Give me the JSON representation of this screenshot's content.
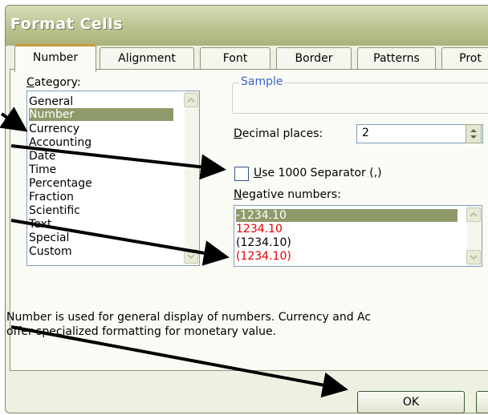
{
  "dialog": {
    "title": "Format Cells"
  },
  "tabs": [
    {
      "label": "Number"
    },
    {
      "label": "Alignment"
    },
    {
      "label": "Font"
    },
    {
      "label": "Border"
    },
    {
      "label": "Patterns"
    },
    {
      "label": "Prot"
    }
  ],
  "category": {
    "label_accel": "C",
    "label_rest": "ategory:",
    "items": [
      "General",
      "Number",
      "Currency",
      "Accounting",
      "Date",
      "Time",
      "Percentage",
      "Fraction",
      "Scientific",
      "Text",
      "Special",
      "Custom"
    ],
    "selected": "Number"
  },
  "sample": {
    "legend": "Sample",
    "value": ""
  },
  "decimal_places": {
    "label_accel": "D",
    "label_rest": "ecimal places:",
    "value": "2"
  },
  "separator": {
    "label_accel": "U",
    "label_rest": "se 1000 Separator (,)",
    "checked": false
  },
  "negative_numbers": {
    "label_accel": "N",
    "label_rest": "egative numbers:",
    "items": [
      {
        "text": "-1234.10",
        "color": "#000000",
        "selected": true
      },
      {
        "text": "1234.10",
        "color": "#e00000",
        "selected": false
      },
      {
        "text": "(1234.10)",
        "color": "#000000",
        "selected": false
      },
      {
        "text": "(1234.10)",
        "color": "#e00000",
        "selected": false
      }
    ]
  },
  "description": {
    "line1": "Number is used for general display of numbers.  Currency and Ac",
    "line2": "offer specialized formatting for monetary value."
  },
  "buttons": {
    "ok": "OK",
    "cancel": ""
  },
  "colors": {
    "title_bar": "#bcc390",
    "selection": "#8f9a6a",
    "active_tab_accent": "#c79a3a",
    "arrow": "#000000",
    "negative_red": "#e00000"
  }
}
